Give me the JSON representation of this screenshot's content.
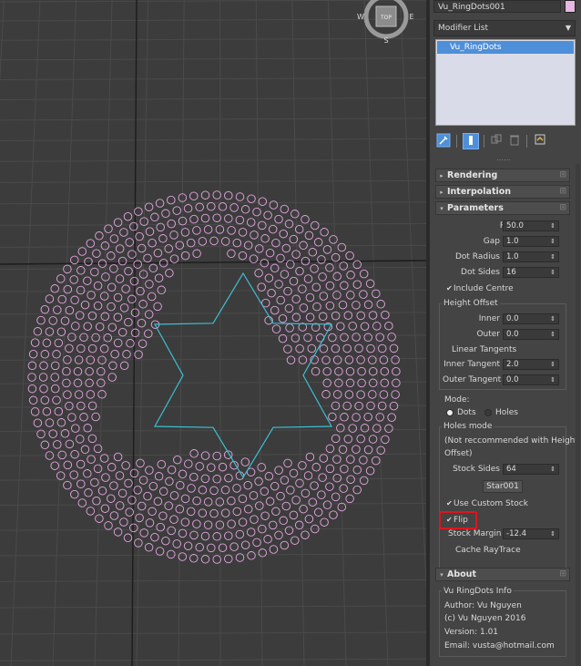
{
  "viewport": {
    "viewcube": {
      "west": "W",
      "east": "E",
      "south": "S",
      "top": "TOP"
    },
    "colors": {
      "background": "#3c3c3c",
      "grid": "#4a4a4a",
      "axis": "#1c1c1c",
      "dots": "#e6a7e3",
      "star": "#3cc0d4"
    }
  },
  "panel": {
    "object_name": "Vu_RingDots001",
    "object_color": "#e8b7e3",
    "modifier_list_label": "Modifier List",
    "stack_items": [
      "Vu_RingDots"
    ],
    "toolbar_icons": [
      "pin-stack-icon",
      "show-end-result-icon",
      "make-unique-icon",
      "remove-modifier-icon",
      "configure-sets-icon"
    ],
    "rollouts": {
      "rendering": "Rendering",
      "interpolation": "Interpolation",
      "parameters": "Parameters",
      "about": "About"
    },
    "parameters": {
      "radius_label": "Radius",
      "radius_value": "50.0",
      "gap_label": "Gap",
      "gap_value": "1.0",
      "dot_radius_label": "Dot Radius",
      "dot_radius_value": "1.0",
      "dot_sides_label": "Dot Sides",
      "dot_sides_value": "16",
      "include_centre_label": "Include Centre",
      "include_centre_checked": true,
      "height_offset_title": "Height Offset",
      "inner_label": "Inner",
      "inner_value": "0.0",
      "outer_label": "Outer",
      "outer_value": "0.0",
      "linear_tangents_label": "Linear Tangents",
      "linear_tangents_checked": false,
      "inner_tangent_label": "Inner Tangent",
      "inner_tangent_value": "2.0",
      "outer_tangent_label": "Outer Tangent",
      "outer_tangent_value": "0.0",
      "mode_label": "Mode:",
      "mode_dots_label": "Dots",
      "mode_holes_label": "Holes",
      "mode_selected": "Dots",
      "holes_mode_title": "Holes mode",
      "holes_note_line1": "(Not reccommended with Height",
      "holes_note_line2": "Offset)",
      "stock_sides_label": "Stock Sides",
      "stock_sides_value": "64",
      "stock_pick_button": "Star001",
      "use_custom_stock_label": "Use Custom Stock",
      "use_custom_stock_checked": true,
      "flip_label": "Flip",
      "flip_checked": true,
      "stock_margin_label": "Stock Margin",
      "stock_margin_value": "-12.4",
      "cache_raytrace_label": "Cache RayTrace"
    },
    "about": {
      "title": "Vu RingDots Info",
      "author": "Author: Vu Nguyen",
      "copyright": "(c) Vu Nguyen 2016",
      "version": "Version: 1.01",
      "email": "Email: vusta@hotmail.com"
    }
  }
}
